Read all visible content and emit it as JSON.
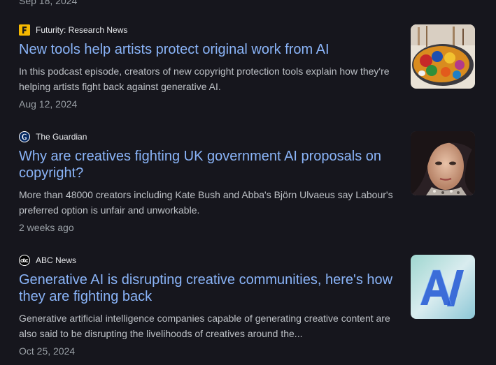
{
  "top_item": {
    "date": "Sep 18, 2024"
  },
  "articles": [
    {
      "source": "Futurity: Research News",
      "source_icon": "futurity-logo-icon",
      "title": "New tools help artists protect original work from AI",
      "snippet": "In this podcast episode, creators of new copyright protection tools explain how they're helping artists fight back against generative AI.",
      "date": "Aug 12, 2024",
      "thumbnail": "paint-palette-thumbnail"
    },
    {
      "source": "The Guardian",
      "source_icon": "guardian-logo-icon",
      "title": "Why are creatives fighting UK government AI proposals on copyright?",
      "snippet": "More than 48000 creators including Kate Bush and Abba's Björn Ulvaeus say Labour's preferred option is unfair and unworkable.",
      "date": "2 weeks ago",
      "thumbnail": "portrait-thumbnail"
    },
    {
      "source": "ABC News",
      "source_icon": "abc-news-logo-icon",
      "title": "Generative AI is disrupting creative communities, here's how they are fighting back",
      "snippet": "Generative artificial intelligence companies capable of generating creative content are also said to be disrupting the livelihoods of creatives around the...",
      "date": "Oct 25, 2024",
      "thumbnail": "ai-letters-thumbnail"
    }
  ],
  "colors": {
    "background": "#16161d",
    "link": "#8ab4f8",
    "text": "#bdc1c6",
    "muted": "#9aa0a6"
  }
}
